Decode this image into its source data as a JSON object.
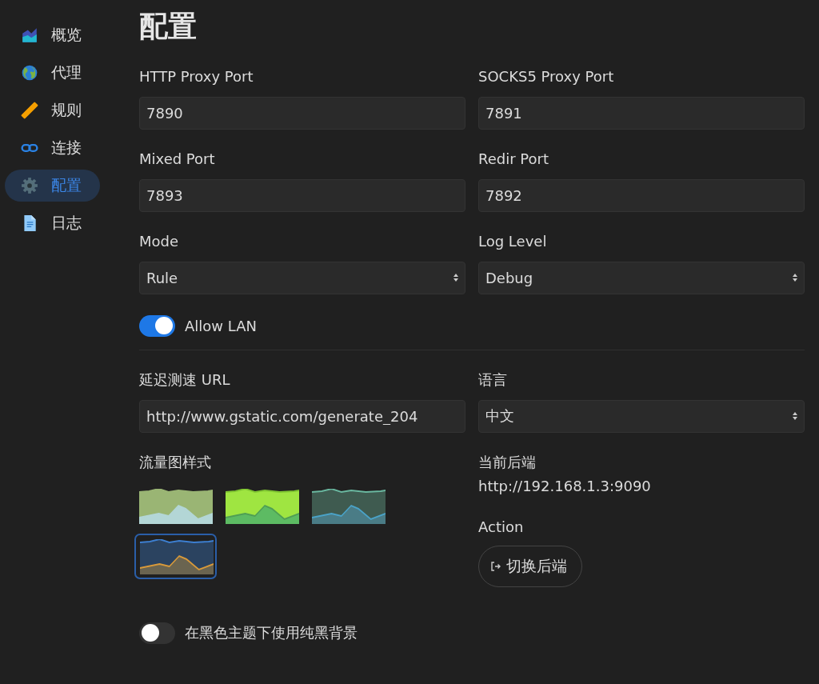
{
  "sidebar": {
    "items": [
      {
        "label": "概览",
        "selected": false
      },
      {
        "label": "代理",
        "selected": false
      },
      {
        "label": "规则",
        "selected": false
      },
      {
        "label": "连接",
        "selected": false
      },
      {
        "label": "配置",
        "selected": true
      },
      {
        "label": "日志",
        "selected": false
      }
    ]
  },
  "page_title": "配置",
  "fields": [
    {
      "kind": "input",
      "label": "HTTP Proxy Port",
      "value": "7890"
    },
    {
      "kind": "input",
      "label": "SOCKS5 Proxy Port",
      "value": "7891"
    },
    {
      "kind": "input",
      "label": "Mixed Port",
      "value": "7893"
    },
    {
      "kind": "input",
      "label": "Redir Port",
      "value": "7892"
    },
    {
      "kind": "select",
      "label": "Mode",
      "value": "Rule"
    },
    {
      "kind": "select",
      "label": "Log Level",
      "value": "Debug"
    }
  ],
  "allow_lan": {
    "label": "Allow LAN",
    "on": true
  },
  "latency_url": {
    "label": "延迟测速 URL",
    "value": "http://www.gstatic.com/generate_204"
  },
  "language": {
    "label": "语言",
    "value": "中文"
  },
  "traffic_chart_style": {
    "label": "流量图样式",
    "styles": [
      {
        "color": "#9ab574",
        "selected": false
      },
      {
        "color": "#9fe541",
        "selected": false
      },
      {
        "color": "#3f5b50",
        "selected": false
      },
      {
        "color": "#2b4360",
        "selected": true
      }
    ]
  },
  "current_backend": {
    "label": "当前后端",
    "value": "http://192.168.1.3:9090"
  },
  "action": {
    "label": "Action",
    "button": "切换后端"
  },
  "pure_black": {
    "label": "在黑色主题下使用纯黑背景",
    "on": false
  }
}
